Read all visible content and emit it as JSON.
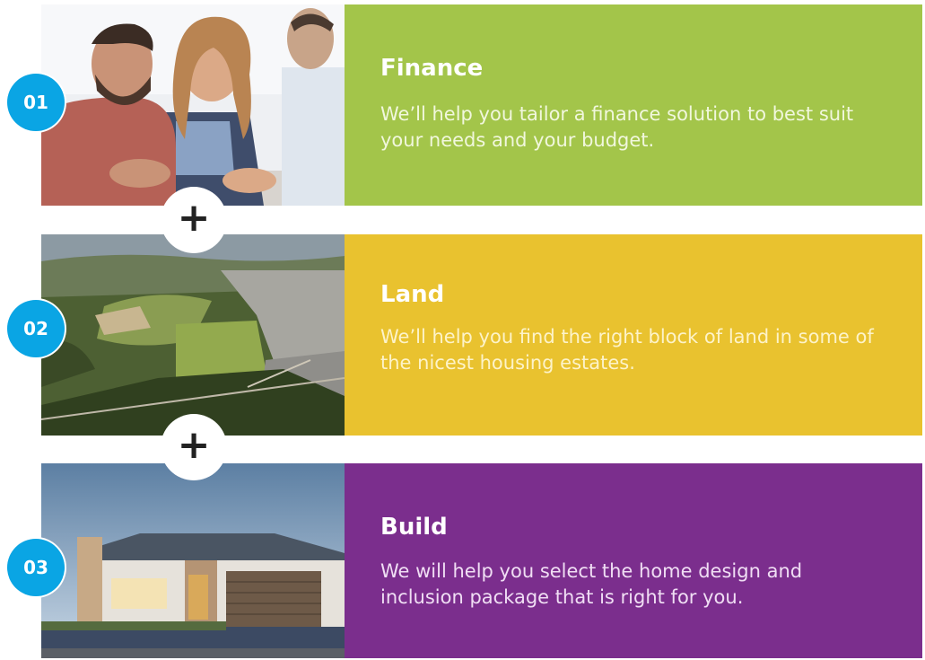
{
  "colors": {
    "badge": "#0aa5e4",
    "finance": "#a3c54a",
    "land": "#e9c22f",
    "build": "#7b2e8d",
    "finance_text": "#f1f7dd",
    "land_text": "#fdf3c9",
    "build_text": "#f0def4"
  },
  "steps": [
    {
      "number": "01",
      "title": "Finance",
      "description": "We’ll help you tailor a finance solution to best suit your needs and your budget."
    },
    {
      "number": "02",
      "title": "Land",
      "description": "We’ll help you find the right block of land in some of the nicest housing estates."
    },
    {
      "number": "03",
      "title": "Build",
      "description": "We will help you select the home design and inclusion package that is right for you."
    }
  ],
  "connector": "+"
}
